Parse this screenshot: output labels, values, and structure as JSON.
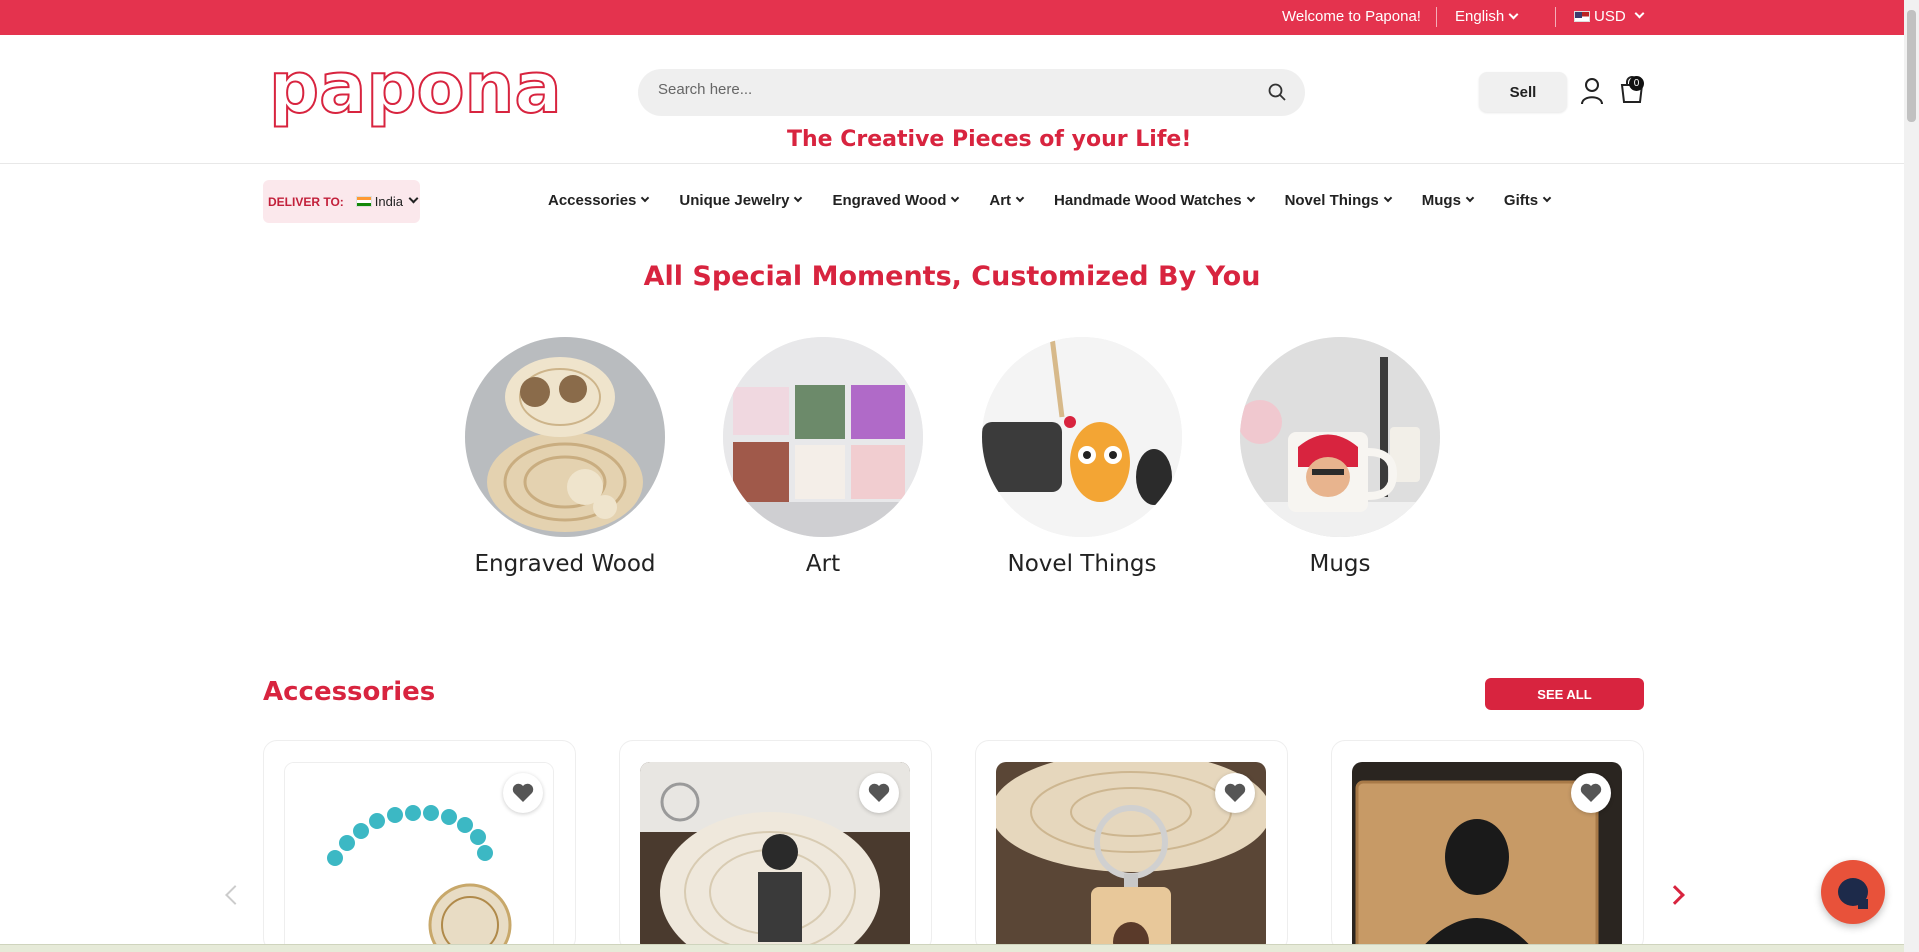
{
  "topbar": {
    "welcome": "Welcome to Papona!",
    "language": "English",
    "currency": "USD",
    "bg_color": "#e4334e"
  },
  "header": {
    "logo_text": "papona",
    "search_placeholder": "Search here...",
    "tagline": "The Creative Pieces of your Life!",
    "sell_label": "Sell",
    "cart_count": "0"
  },
  "nav": {
    "deliver_label": "DELIVER TO:",
    "deliver_country": "India",
    "items": [
      {
        "label": "Accessories"
      },
      {
        "label": "Unique Jewelry"
      },
      {
        "label": "Engraved Wood"
      },
      {
        "label": "Art"
      },
      {
        "label": "Handmade Wood Watches"
      },
      {
        "label": "Novel Things"
      },
      {
        "label": "Mugs"
      },
      {
        "label": "Gifts"
      }
    ]
  },
  "moments": {
    "heading": "All Special Moments, Customized By You",
    "categories": [
      {
        "label": "Engraved Wood"
      },
      {
        "label": "Art"
      },
      {
        "label": "Novel Things"
      },
      {
        "label": "Mugs"
      }
    ]
  },
  "accessories": {
    "title": "Accessories",
    "see_all": "SEE ALL"
  },
  "colors": {
    "accent": "#d8243f",
    "topbar": "#e4334e"
  }
}
